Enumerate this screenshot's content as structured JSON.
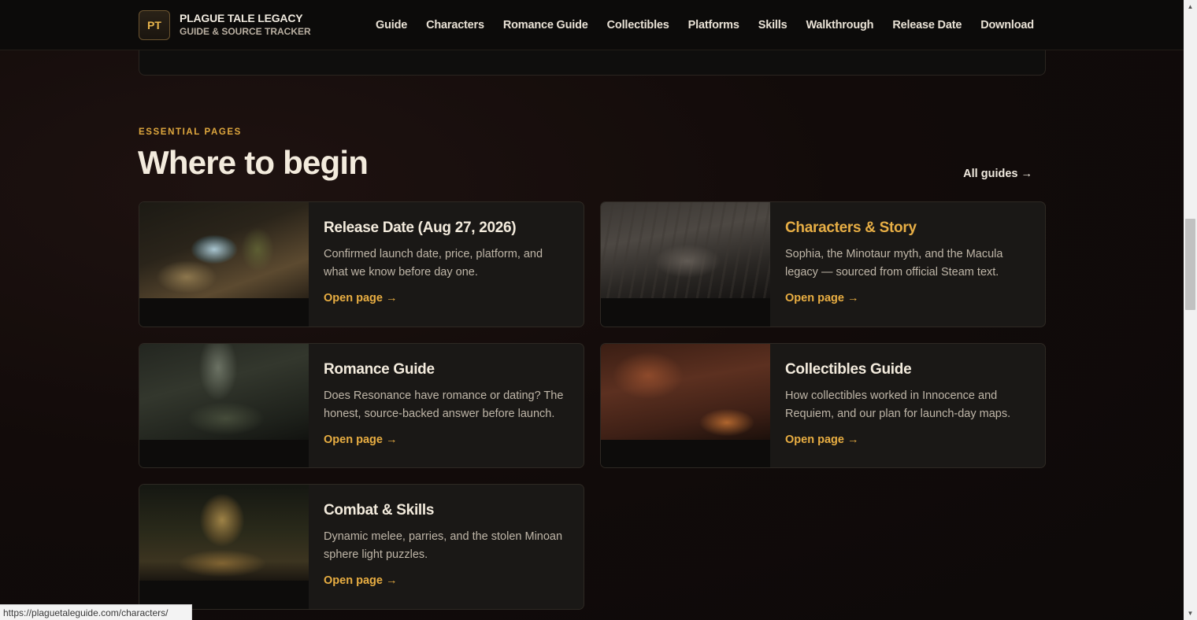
{
  "header": {
    "badge": "PT",
    "title": "PLAGUE TALE LEGACY",
    "subtitle": "GUIDE & SOURCE TRACKER",
    "nav": [
      "Guide",
      "Characters",
      "Romance Guide",
      "Collectibles",
      "Platforms",
      "Skills",
      "Walkthrough",
      "Release Date",
      "Download"
    ]
  },
  "section": {
    "eyebrow": "ESSENTIAL PAGES",
    "heading": "Where to begin",
    "all_guides": "All guides →"
  },
  "cards": [
    {
      "title": "Release Date (Aug 27, 2026)",
      "desc": "Confirmed launch date, price, platform, and what we know before day one.",
      "link": "Open page →"
    },
    {
      "title": "Characters & Story",
      "desc": "Sophia, the Minotaur myth, and the Macula legacy — sourced from official Steam text.",
      "link": "Open page →"
    },
    {
      "title": "Romance Guide",
      "desc": "Does Resonance have romance or dating? The honest, source-backed answer before launch.",
      "link": "Open page →"
    },
    {
      "title": "Collectibles Guide",
      "desc": "How collectibles worked in Innocence and Requiem, and our plan for launch-day maps.",
      "link": "Open page →"
    },
    {
      "title": "Combat & Skills",
      "desc": "Dynamic melee, parries, and the stolen Minoan sphere light puzzles.",
      "link": "Open page →"
    }
  ],
  "status_url": "https://plaguetaleguide.com/characters/",
  "colors": {
    "accent": "#e9ae42",
    "background": "#120b0a",
    "card": "#1a1816"
  }
}
